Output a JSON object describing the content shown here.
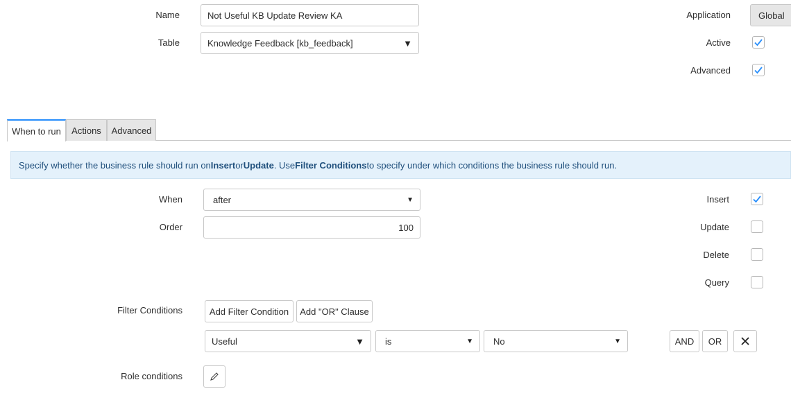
{
  "header": {
    "name_label": "Name",
    "name_value": "Not Useful KB Update Review KA",
    "table_label": "Table",
    "table_value": "Knowledge Feedback [kb_feedback]",
    "application_label": "Application",
    "application_value": "Global",
    "active_label": "Active",
    "active_checked": true,
    "advanced_label": "Advanced",
    "advanced_checked": true
  },
  "tabs": [
    {
      "label": "When to run",
      "active": true
    },
    {
      "label": "Actions",
      "active": false
    },
    {
      "label": "Advanced",
      "active": false
    }
  ],
  "info": {
    "part1": "Specify whether the business rule should run on ",
    "insert": "Insert",
    "part2": " or ",
    "update": "Update",
    "part3": ". Use ",
    "filter_conditions": "Filter Conditions",
    "part4": " to specify under which conditions the business rule should run."
  },
  "when_to_run": {
    "when_label": "When",
    "when_value": "after",
    "order_label": "Order",
    "order_value": "100",
    "insert_label": "Insert",
    "insert_checked": true,
    "update_label": "Update",
    "update_checked": false,
    "delete_label": "Delete",
    "delete_checked": false,
    "query_label": "Query",
    "query_checked": false,
    "filter_label": "Filter Conditions",
    "add_filter_button": "Add Filter Condition",
    "add_or_button": "Add \"OR\" Clause",
    "condition": {
      "field": "Useful",
      "operator": "is",
      "value": "No"
    },
    "and_button": "AND",
    "or_button": "OR",
    "role_label": "Role conditions"
  },
  "colors": {
    "accent": "#278efc",
    "info_bg": "#e4f1fb",
    "info_text": "#1f4f7c"
  },
  "icons": [
    "checkmark-icon",
    "dropdown-arrow-icon",
    "close-icon",
    "pencil-icon"
  ]
}
